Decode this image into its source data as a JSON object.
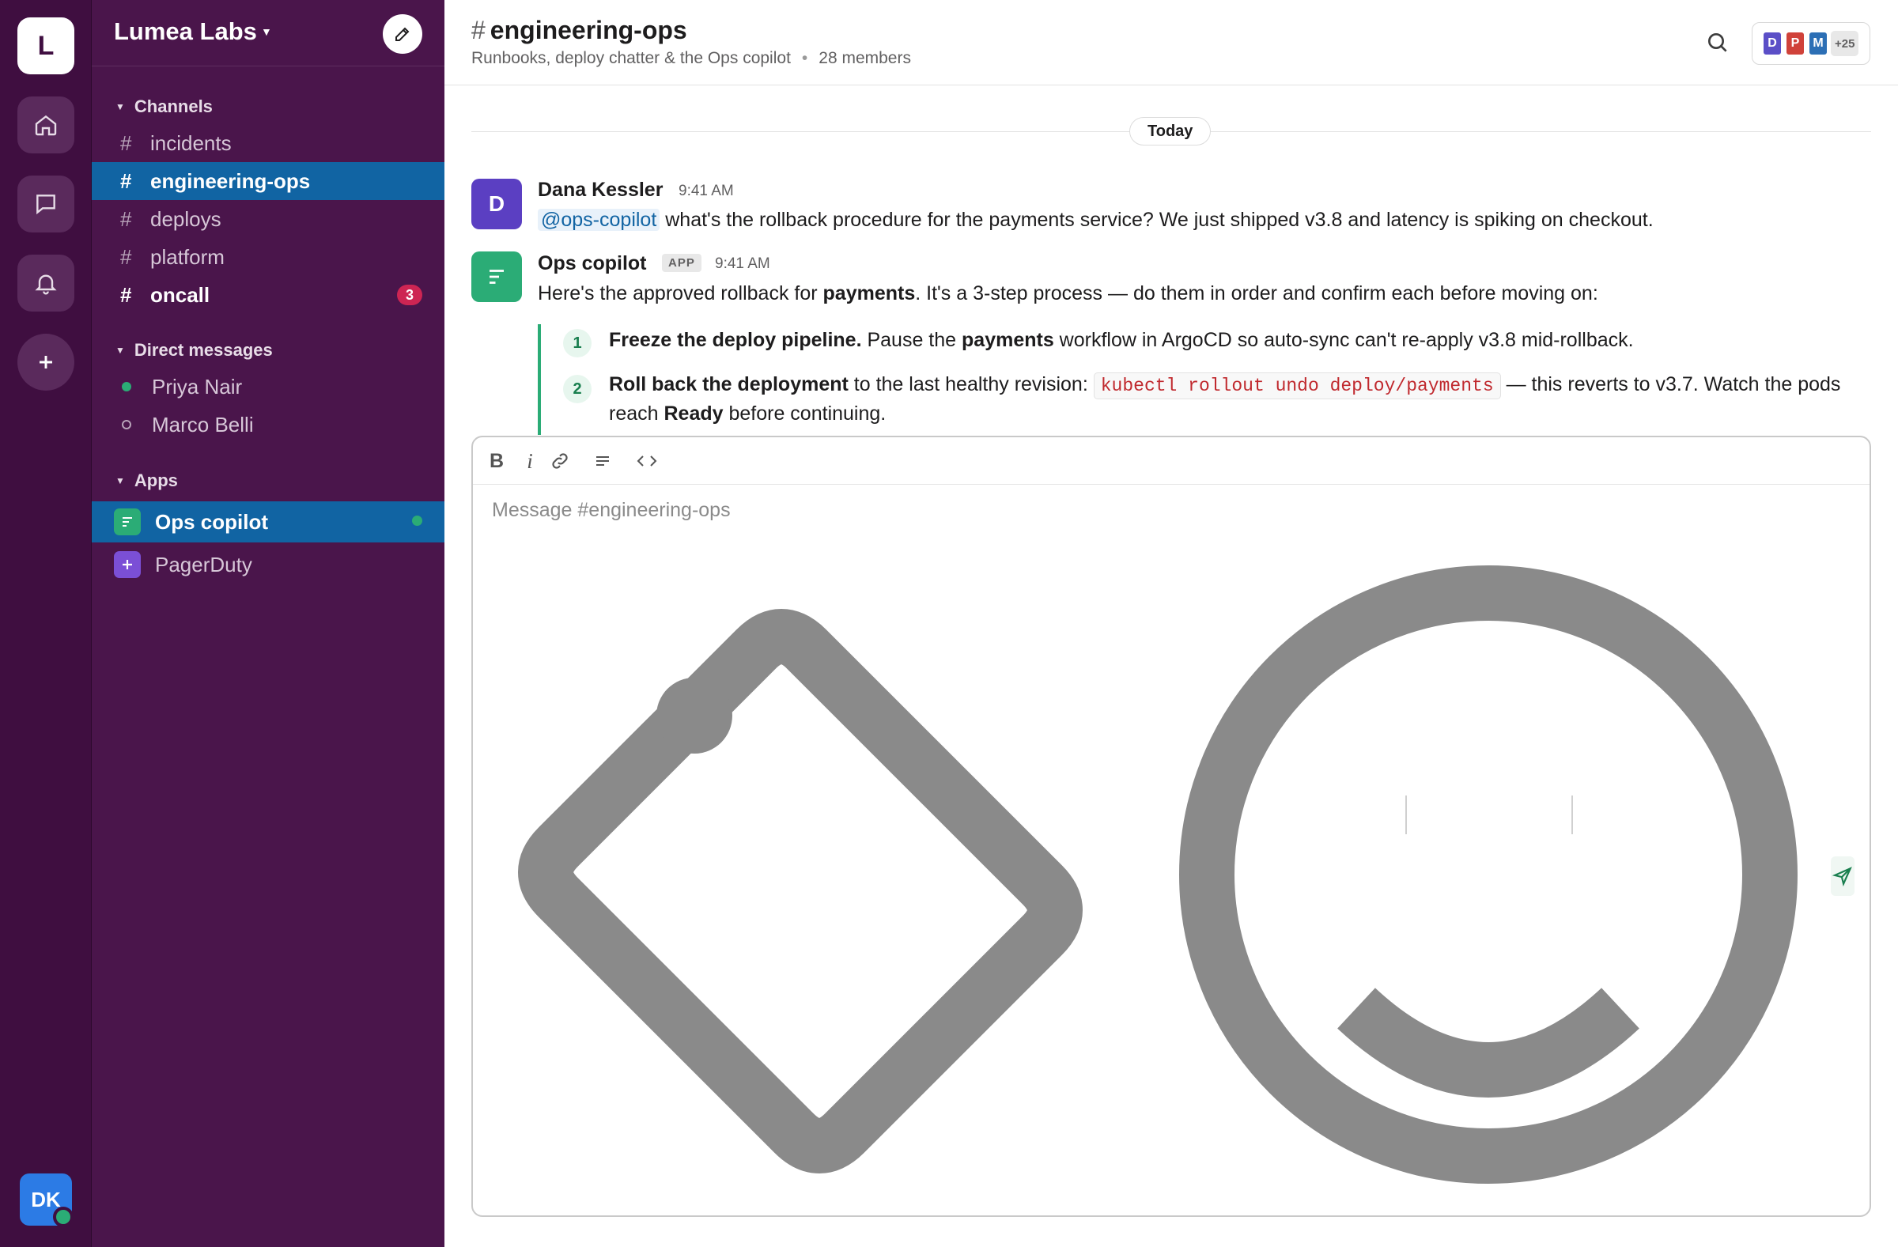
{
  "workspace": {
    "initial": "L",
    "name": "Lumea Labs"
  },
  "user": {
    "initials": "DK"
  },
  "sidebar": {
    "channels_header": "Channels",
    "channels": [
      {
        "label": "incidents"
      },
      {
        "label": "engineering-ops"
      },
      {
        "label": "deploys"
      },
      {
        "label": "platform"
      },
      {
        "label": "oncall",
        "badge": "3"
      }
    ],
    "dms_header": "Direct messages",
    "dms": [
      {
        "label": "Priya Nair"
      },
      {
        "label": "Marco Belli"
      }
    ],
    "apps_header": "Apps",
    "apps": [
      {
        "label": "Ops copilot"
      },
      {
        "label": "PagerDuty"
      }
    ]
  },
  "channel": {
    "hash": "#",
    "name": "engineering-ops",
    "topic": "Runbooks, deploy chatter & the Ops copilot",
    "members_label": "28 members",
    "member_avatars": [
      "D",
      "P",
      "M"
    ],
    "member_more": "+25"
  },
  "day_divider": "Today",
  "messages": [
    {
      "avatar": "D",
      "author": "Dana Kessler",
      "time": "9:41 AM",
      "mention": "@ops-copilot",
      "text": "what's the rollback procedure for the payments service? We just shipped v3.8 and latency is spiking on checkout."
    },
    {
      "author": "Ops copilot",
      "tag": "APP",
      "time": "9:41 AM",
      "intro_a": "Here's the approved rollback for ",
      "intro_bold": "payments",
      "intro_b": ". It's a 3-step process — do them in order and confirm each before moving on:",
      "steps": [
        {
          "num": "1",
          "bold": "Freeze the deploy pipeline.",
          "a": " Pause the ",
          "bold2": "payments",
          "b": " workflow in ArgoCD so auto-sync can't re-apply v3.8 mid-rollback."
        },
        {
          "num": "2",
          "bold": "Roll back the deployment",
          "a": " to the last healthy revision: ",
          "code": "kubectl rollout undo deploy/payments",
          "b": " — this reverts to v3.7. Watch the pods",
          "line2_a": "reach ",
          "line2_bold": "Ready",
          "line2_b": " before continuing."
        }
      ]
    }
  ],
  "composer": {
    "placeholder": "Message #engineering-ops"
  },
  "colors": {
    "rail": "#3f0e40",
    "sidebar": "#4a154b",
    "active": "#1164a3",
    "accent_green": "#2bac76",
    "badge": "#cd2553"
  }
}
